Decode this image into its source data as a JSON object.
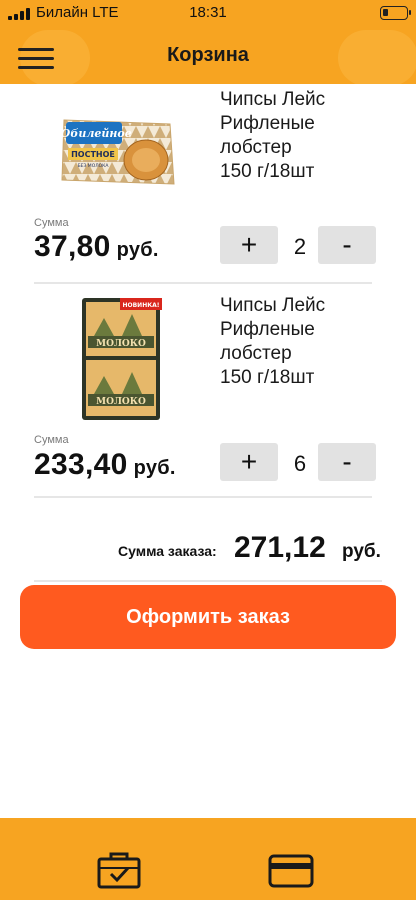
{
  "status": {
    "carrier": "Билайн LTE",
    "time": "18:31"
  },
  "header": {
    "title": "Корзина",
    "menu_icon": "hamburger-icon"
  },
  "cart": {
    "items": [
      {
        "name_lines": [
          "Чипсы Лейс",
          "Рифленые",
          "лобстер",
          "150 г/18шт"
        ],
        "sum_label": "Сумма",
        "price": "37,80",
        "currency": "руб.",
        "quantity": "2",
        "plus_label": "+",
        "minus_label": "-",
        "package_text": [
          "Юбилейное",
          "ПОСТНОЕ",
          "БЕЗ МОЛОКА"
        ]
      },
      {
        "name_lines": [
          "Чипсы Лейс",
          "Рифленые",
          "лобстер",
          "150 г/18шт"
        ],
        "sum_label": "Сумма",
        "price": "233,40",
        "currency": "руб.",
        "quantity": "6",
        "plus_label": "+",
        "minus_label": "-",
        "package_text": [
          "НОВИНКА!",
          "МОЛОКО",
          "МОЛОКО"
        ]
      }
    ]
  },
  "total": {
    "label": "Сумма заказа:",
    "value": "271,12",
    "currency": "руб."
  },
  "checkout": {
    "label": "Оформить заказ"
  },
  "tabbar": {
    "tabs": [
      {
        "icon": "briefcase-check-icon"
      },
      {
        "icon": "credit-card-icon"
      }
    ]
  },
  "colors": {
    "primary": "#f7a421",
    "accent": "#ff5a1f",
    "stepper": "#e2e2e2"
  }
}
